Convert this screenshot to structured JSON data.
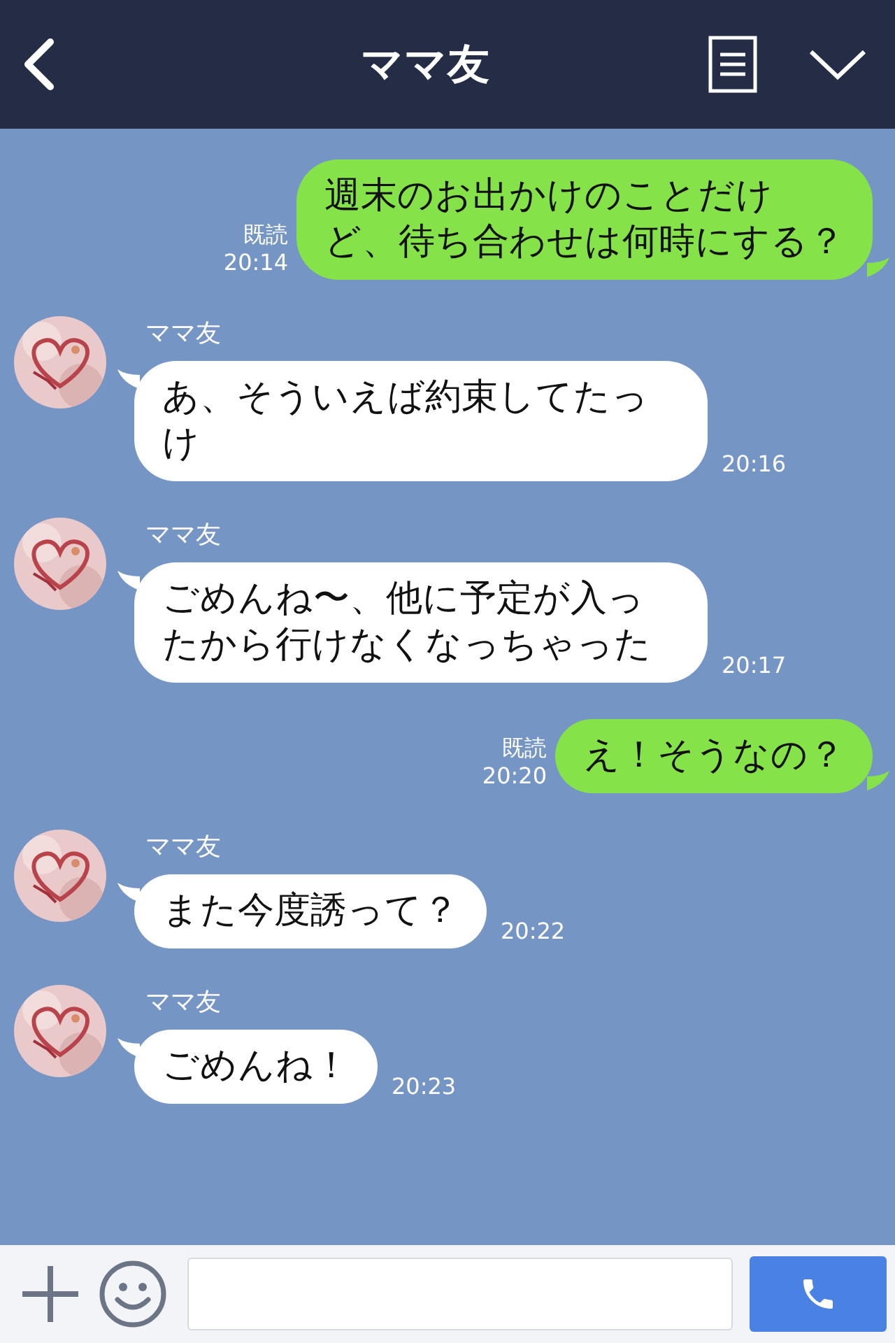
{
  "header": {
    "title": "ママ友"
  },
  "messages": [
    {
      "kind": "sent",
      "text": "週末のお出かけのことだけど、待ち合わせは何時にする？",
      "read_label": "既読",
      "time": "20:14"
    },
    {
      "kind": "received",
      "sender": "ママ友",
      "text": "あ、そういえば約束してたっけ",
      "time": "20:16"
    },
    {
      "kind": "received",
      "sender": "ママ友",
      "text": "ごめんね〜、他に予定が入ったから行けなくなっちゃった",
      "time": "20:17"
    },
    {
      "kind": "sent",
      "text": "え！そうなの？",
      "read_label": "既読",
      "time": "20:20"
    },
    {
      "kind": "received",
      "sender": "ママ友",
      "text": "また今度誘って？",
      "time": "20:22"
    },
    {
      "kind": "received",
      "sender": "ママ友",
      "text": "ごめんね！",
      "time": "20:23"
    }
  ]
}
